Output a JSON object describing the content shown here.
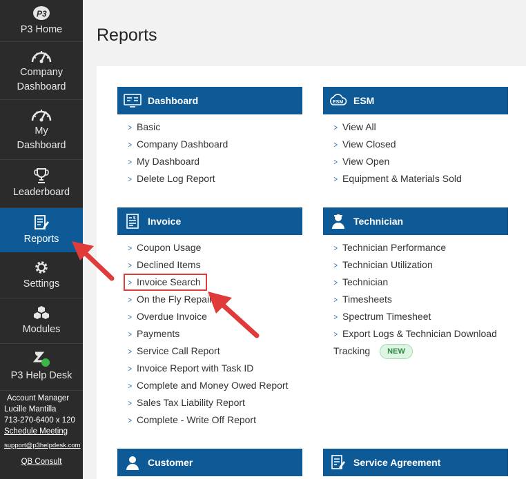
{
  "sidebar": {
    "items": [
      {
        "label": "P3 Home",
        "icon": "p3-logo-icon"
      },
      {
        "label": "Company\nDashboard",
        "icon": "gauge-icon"
      },
      {
        "label": "My\nDashboard",
        "icon": "gauge-icon"
      },
      {
        "label": "Leaderboard",
        "icon": "trophy-icon"
      },
      {
        "label": "Reports",
        "icon": "report-icon",
        "active": true
      },
      {
        "label": "Settings",
        "icon": "gear-icon"
      },
      {
        "label": "Modules",
        "icon": "cubes-icon"
      },
      {
        "label": "P3 Help Desk",
        "icon": "zendesk-icon"
      }
    ],
    "account": {
      "title": "Account Manager",
      "name": "Lucille Mantilla",
      "phone": "713-270-6400 x 120",
      "schedule": "Schedule Meeting",
      "email": "support@p3helpdesk.com",
      "qb": "QB Consult"
    }
  },
  "page": {
    "title": "Reports"
  },
  "sections": {
    "dashboard": {
      "title": "Dashboard",
      "links": [
        "Basic",
        "Company Dashboard",
        "My Dashboard",
        "Delete Log Report"
      ]
    },
    "esm": {
      "title": "ESM",
      "links": [
        "View All",
        "View Closed",
        "View Open",
        "Equipment & Materials Sold"
      ]
    },
    "invoice": {
      "title": "Invoice",
      "links": [
        "Coupon Usage",
        "Declined Items",
        "Invoice Search",
        "On the Fly Repair",
        "Overdue Invoice",
        "Payments",
        "Service Call Report",
        "Invoice Report with Task ID",
        "Complete and Money Owed Report",
        "Sales Tax Liability Report",
        "Complete - Write Off Report"
      ]
    },
    "technician": {
      "title": "Technician",
      "links": [
        "Technician Performance",
        "Technician Utilization",
        "Technician",
        "Timesheets",
        "Spectrum Timesheet",
        "Export Logs & Technician Download"
      ],
      "tracking": "Tracking",
      "badge": "NEW"
    },
    "customer": {
      "title": "Customer"
    },
    "service_agreement": {
      "title": "Service Agreement"
    }
  },
  "colors": {
    "sidebar_bg": "#2b2b2b",
    "accent_blue": "#0d5a96",
    "annotation_red": "#e03b3b",
    "new_badge": "#2e8b45"
  }
}
